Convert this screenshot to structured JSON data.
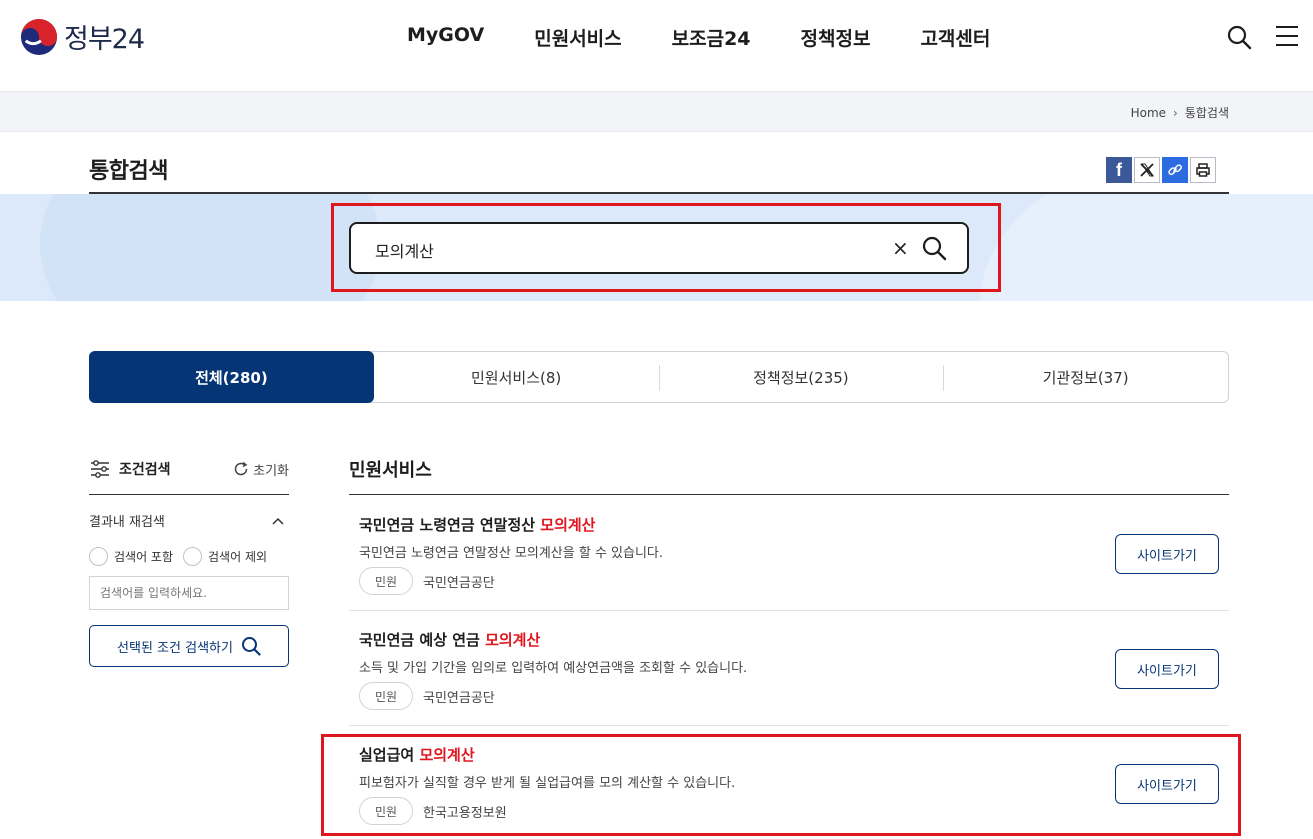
{
  "header": {
    "logo_text": "정부24",
    "nav": [
      "MyGOV",
      "민원서비스",
      "보조금24",
      "정책정보",
      "고객센터"
    ]
  },
  "breadcrumb": {
    "home": "Home",
    "current": "통합검색"
  },
  "page": {
    "title": "통합검색"
  },
  "share": {
    "facebook_glyph": "f"
  },
  "search": {
    "value": "모의계산",
    "clear_glyph": "×"
  },
  "tabs": [
    {
      "label": "전체(280)",
      "active": true
    },
    {
      "label": "민원서비스(8)",
      "active": false
    },
    {
      "label": "정책정보(235)",
      "active": false
    },
    {
      "label": "기관정보(37)",
      "active": false
    }
  ],
  "filter": {
    "title": "조건검색",
    "reset": "초기화",
    "refine_title": "결과내 재검색",
    "include": "검색어 포함",
    "exclude": "검색어 제외",
    "placeholder": "검색어를 입력하세요.",
    "button": "선택된 조건 검색하기"
  },
  "results": {
    "section_title": "민원서비스",
    "button_label": "사이트가기",
    "items": [
      {
        "title_prefix": "국민연금 노령연금 연말정산 ",
        "title_highlight": "모의계산",
        "desc": "국민연금 노령연금 연말정산 모의계산을 할 수 있습니다.",
        "badge": "민원",
        "org": "국민연금공단"
      },
      {
        "title_prefix": "국민연금 예상 연금 ",
        "title_highlight": "모의계산",
        "desc": "소득 및 가입 기간을 임의로 입력하여 예상연금액을 조회할 수 있습니다.",
        "badge": "민원",
        "org": "국민연금공단"
      },
      {
        "title_prefix": "실업급여 ",
        "title_highlight": "모의계산",
        "desc": "피보험자가 실직할 경우 받게 될 실업급여를 모의 계산할 수 있습니다.",
        "badge": "민원",
        "org": "한국고용정보원"
      }
    ]
  },
  "colors": {
    "primary": "#063575",
    "highlight": "#e0161e",
    "band": "#dbe9fb"
  },
  "icons": [
    "government-emblem-icon",
    "search-icon",
    "hamburger-menu-icon",
    "chevron-right-icon",
    "facebook-icon",
    "x-icon",
    "link-icon",
    "print-icon",
    "clear-icon",
    "filter-sliders-icon",
    "refresh-icon",
    "chevron-up-icon"
  ]
}
